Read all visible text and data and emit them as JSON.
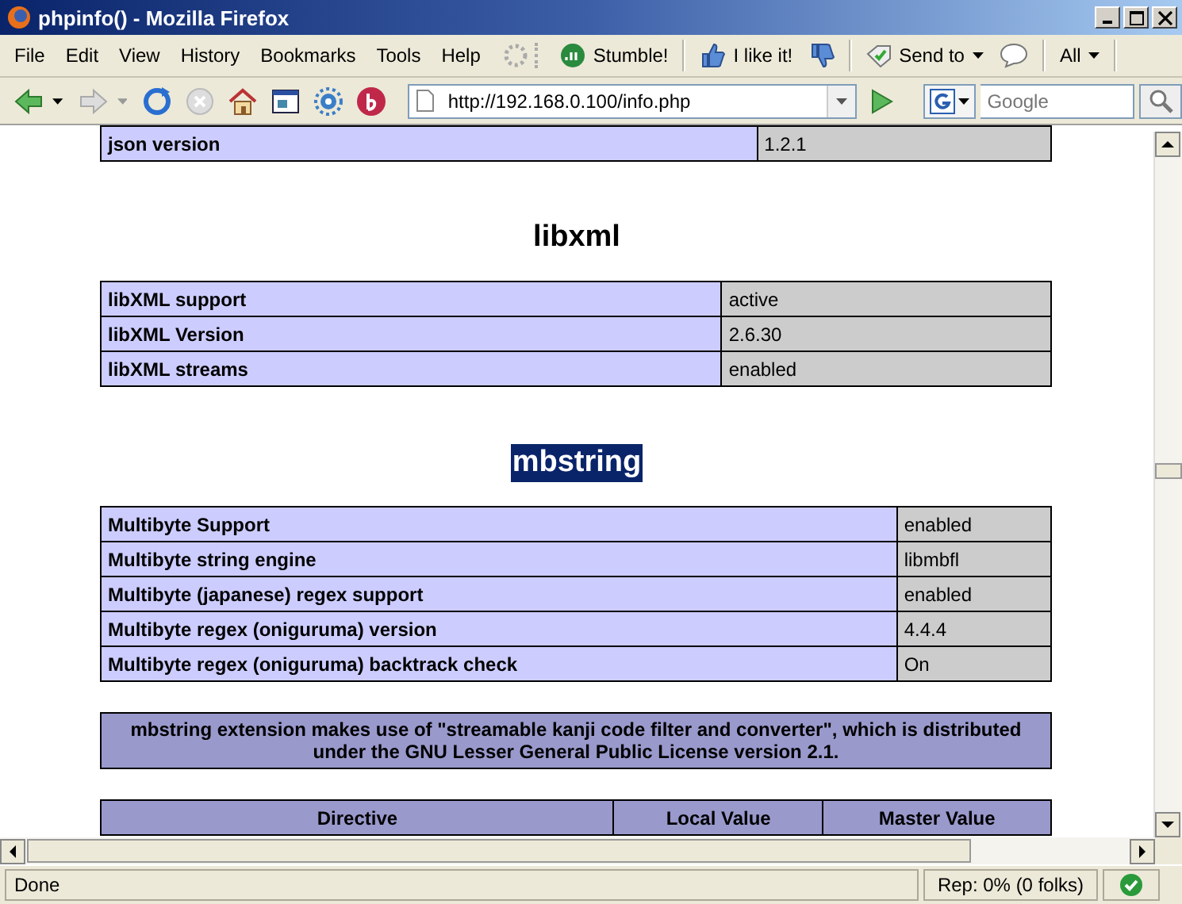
{
  "window": {
    "title": "phpinfo() - Mozilla Firefox"
  },
  "menu": [
    "File",
    "Edit",
    "View",
    "History",
    "Bookmarks",
    "Tools",
    "Help"
  ],
  "toolbar": [
    {
      "kind": "stumble",
      "label": "Stumble!"
    },
    {
      "kind": "like",
      "label": "I like it!"
    },
    {
      "kind": "dislike"
    },
    {
      "kind": "send",
      "label": "Send to"
    },
    {
      "kind": "comment"
    },
    {
      "kind": "all",
      "label": "All"
    }
  ],
  "address": {
    "value": "http://192.168.0.100/info.php"
  },
  "search": {
    "placeholder": "Google"
  },
  "page": [
    {
      "kind": "table",
      "rows": [
        [
          "json version",
          "1.2.1"
        ]
      ]
    },
    {
      "kind": "heading",
      "text": "libxml",
      "selected": false
    },
    {
      "kind": "table",
      "rows": [
        [
          "libXML support",
          "active"
        ],
        [
          "libXML Version",
          "2.6.30"
        ],
        [
          "libXML streams",
          "enabled"
        ]
      ]
    },
    {
      "kind": "heading",
      "text": "mbstring",
      "selected": true
    },
    {
      "kind": "table",
      "rows": [
        [
          "Multibyte Support",
          "enabled"
        ],
        [
          "Multibyte string engine",
          "libmbfl"
        ],
        [
          "Multibyte (japanese) regex support",
          "enabled"
        ],
        [
          "Multibyte regex (oniguruma) version",
          "4.4.4"
        ],
        [
          "Multibyte regex (oniguruma) backtrack check",
          "On"
        ]
      ]
    },
    {
      "kind": "notice",
      "text": "mbstring extension makes use of \"streamable kanji code filter and converter\", which is distributed under the GNU Lesser General Public License version 2.1."
    },
    {
      "kind": "header",
      "columns": [
        "Directive",
        "Local Value",
        "Master Value"
      ]
    }
  ],
  "status_bar": {
    "text": "Done",
    "rep": "Rep: 0% (0 folks)"
  }
}
